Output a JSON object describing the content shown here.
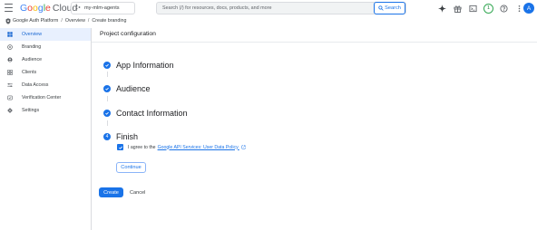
{
  "header": {
    "logo": {
      "google": "Google",
      "cloud": "Cloud"
    },
    "project_picker": "my-mlm-agents",
    "search": {
      "placeholder": "Search (/) for resources, docs, products, and more",
      "button_label": "Search"
    },
    "notifications_count": "1",
    "avatar_letter": "A",
    "icons": [
      "gemini-icon",
      "gift-icon",
      "terminal-icon",
      "notifications-icon",
      "help-icon",
      "more-vert-icon"
    ]
  },
  "breadcrumb": {
    "items": [
      "Google Auth Platform",
      "Overview",
      "Create branding"
    ],
    "separator": "/"
  },
  "sidebar": {
    "items": [
      {
        "label": "Overview",
        "icon": "dashboard-icon",
        "active": true
      },
      {
        "label": "Branding",
        "icon": "branding-icon",
        "active": false
      },
      {
        "label": "Audience",
        "icon": "audience-icon",
        "active": false
      },
      {
        "label": "Clients",
        "icon": "clients-icon",
        "active": false
      },
      {
        "label": "Data Access",
        "icon": "data-access-icon",
        "active": false
      },
      {
        "label": "Verification Center",
        "icon": "verification-icon",
        "active": false
      },
      {
        "label": "Settings",
        "icon": "settings-icon",
        "active": false
      }
    ]
  },
  "main": {
    "title": "Project configuration",
    "steps": [
      {
        "label": "App Information",
        "state": "complete"
      },
      {
        "label": "Audience",
        "state": "complete"
      },
      {
        "label": "Contact Information",
        "state": "complete"
      },
      {
        "label": "Finish",
        "state": "current",
        "number": "4"
      }
    ],
    "agree": {
      "prefix": "I agree to the",
      "link": "Google API Services: User Data Policy.",
      "checked": true
    },
    "continue_label": "Continue",
    "create_label": "Create",
    "cancel_label": "Cancel"
  },
  "colors": {
    "accent": "#1a73e8",
    "active_bg": "#e8f0fe",
    "border": "#dadce0"
  }
}
